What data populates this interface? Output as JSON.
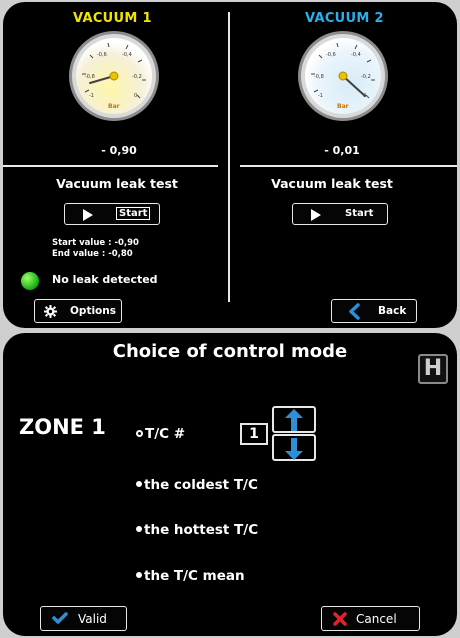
{
  "vacuum_panel": {
    "vacuum1": {
      "title": "VACUUM 1",
      "reading": "- 0,90",
      "unit": "Bar",
      "value": -0.9,
      "scale_labels": [
        "-0,6",
        "-0,4",
        "-0,8",
        "-0,2",
        "-1",
        "0"
      ]
    },
    "vacuum2": {
      "title": "VACUUM 2",
      "reading": "- 0,01",
      "unit": "Bar",
      "value": -0.01,
      "scale_labels": [
        "-0,6",
        "-0,4",
        "-0,8",
        "-0,2",
        "-1",
        "0"
      ]
    },
    "left_test": {
      "title": "Vacuum leak test",
      "start_label": "Start",
      "start_value": "Start value : -0,90",
      "end_value": "End value : -0,80",
      "status": "No leak detected"
    },
    "right_test": {
      "title": "Vacuum leak test",
      "start_label": "Start"
    },
    "options_label": "Options",
    "back_label": "Back",
    "colors": {
      "vacuum1": "#f2e300",
      "vacuum2": "#2ab0ea",
      "led": "#22b81a"
    }
  },
  "control_mode": {
    "title": "Choice of control mode",
    "badge": "H",
    "zone_label": "ZONE 1",
    "options": [
      "T/C #",
      "the coldest T/C",
      "the hottest T/C",
      "the T/C mean"
    ],
    "selected_option": "T/C #",
    "tc_number": "1",
    "valid_label": "Valid",
    "cancel_label": "Cancel",
    "colors": {
      "arrow": "#2f8fd6",
      "valid_check": "#2f8fd6",
      "cancel_x": "#e0232b"
    }
  }
}
